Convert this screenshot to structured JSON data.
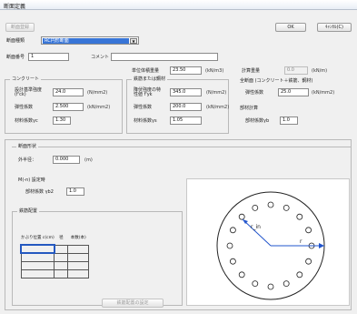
{
  "window": {
    "title": "断面定義"
  },
  "toolbar": {
    "register_label": "断面登録",
    "ok_label": "OK",
    "cancel_label": "ｷｬﾝｾﾙ(C)"
  },
  "section": {
    "type_label": "断面種類",
    "type_value": "RC円形断面",
    "number_label": "断面番号",
    "number_value": "1",
    "comment_label": "コメント",
    "comment_value": ""
  },
  "materials": {
    "unit_weight_label": "単位体積重量",
    "unit_weight_value": "23.50",
    "unit_weight_unit": "(kN/m3)",
    "concrete_group": "コンクリート",
    "design_strength_label": "設計基準強度 (f'ck)",
    "design_strength_value": "24.0",
    "design_strength_unit": "(N/mm2)",
    "elastic_label": "弾性係数",
    "elastic_value": "2.500",
    "elastic_unit": "(kN/mm2)",
    "material_factor_label": "材料係数γc",
    "material_factor_value": "1.30",
    "rebar_group": "鉄筋または鋼材",
    "yield_label": "降伏強度の特性値 f'yk",
    "yield_value": "345.0",
    "yield_unit": "(N/mm2)",
    "rebar_elastic_label": "弾性係数",
    "rebar_elastic_value": "200.0",
    "rebar_elastic_unit": "(kN/mm2)",
    "rebar_factor_label": "材料係数γs",
    "rebar_factor_value": "1.05",
    "calc_weight_label": "計算重量",
    "calc_weight_value": "0.0",
    "calc_weight_unit": "(kN/m)",
    "total_group": "全断面 (コンクリート＋鉄筋、鋼材)",
    "total_elastic_label": "弾性係数",
    "total_elastic_value": "25.0",
    "total_elastic_unit": "(kN/mm2)",
    "member_group": "部材計算",
    "member_factor_label": "部材係数γb",
    "member_factor_value": "1.0"
  },
  "geometry": {
    "group": "断面形状",
    "diameter_label": "外半径：",
    "diameter_value": "0.000",
    "diameter_unit": "(m)"
  },
  "mn": {
    "group": "M(-n) 設定時",
    "factor_label": "部材係数 γb2",
    "factor_value": "1.0"
  },
  "rebar": {
    "group": "鉄筋配置",
    "col1": "かぶり位置 c(cm)",
    "col2": "径",
    "col3": "本数(本)",
    "rows": 4,
    "edit_label": "鉄筋配置の設定"
  },
  "diagram": {
    "r_in": "r_in",
    "r": "r"
  }
}
